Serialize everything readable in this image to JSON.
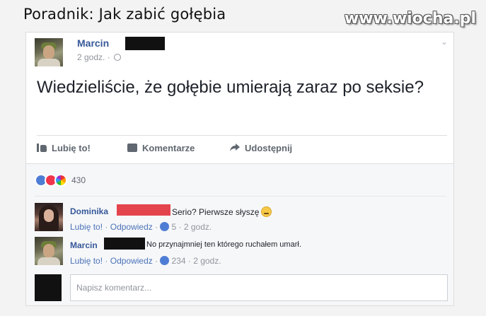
{
  "meme": {
    "title": "Poradnik: Jak zabić gołębia",
    "watermark": "www.wiocha.pl"
  },
  "post": {
    "author": "Marcin",
    "time": "2 godz. ·",
    "privacy_icon": "globe-icon",
    "menu_icon": "chevron-down-icon",
    "text": "Wiedzieliście, że gołębie umierają zaraz po seksie?"
  },
  "actions": {
    "like": "Lubię to!",
    "comment": "Komentarze",
    "share": "Udostępnij"
  },
  "reactions": {
    "icons": [
      "like-icon",
      "love-icon",
      "pride-icon"
    ],
    "count": "430"
  },
  "comments": [
    {
      "author": "Dominika",
      "text": "Serio? Pierwsze słyszę",
      "emoji": "confused-face-icon",
      "like_label": "Lubię to!",
      "reply_label": "Odpowiedz",
      "likes": "5",
      "time": "2 godz."
    },
    {
      "author": "Marcin",
      "text": "No przynajmniej ten którego ruchałem umarł.",
      "like_label": "Lubię to!",
      "reply_label": "Odpowiedz",
      "likes": "234",
      "time": "2 godz."
    }
  ],
  "comment_input": {
    "placeholder": "Napisz komentarz..."
  },
  "colors": {
    "link_blue": "#365899",
    "redaction_black": "#111111",
    "redaction_red": "#e4454d"
  }
}
